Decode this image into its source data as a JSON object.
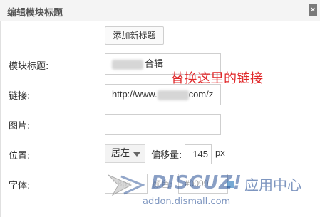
{
  "dialog": {
    "title": "编辑模块标题",
    "close_icon": "close-icon"
  },
  "form": {
    "add_title_button": "添加新标题",
    "module_title": {
      "label": "模块标题:",
      "value_suffix": "合辑"
    },
    "link": {
      "label": "链接:",
      "value_prefix": "http://www.",
      "value_suffix": "com/z"
    },
    "image": {
      "label": "图片:",
      "value": ""
    },
    "position": {
      "label": "位置:",
      "align_value": "居左",
      "offset_label": "偏移量:",
      "offset_value": "145",
      "offset_unit": "px"
    },
    "font": {
      "label": "字体:",
      "size_value": "18px",
      "color_label": "颜色:",
      "color_value": "#0099"
    }
  },
  "annotation": "替换这里的链接",
  "watermark": {
    "brand": "DISCUZ!",
    "cn": "应用中心",
    "url": "addon.dismall.com"
  }
}
